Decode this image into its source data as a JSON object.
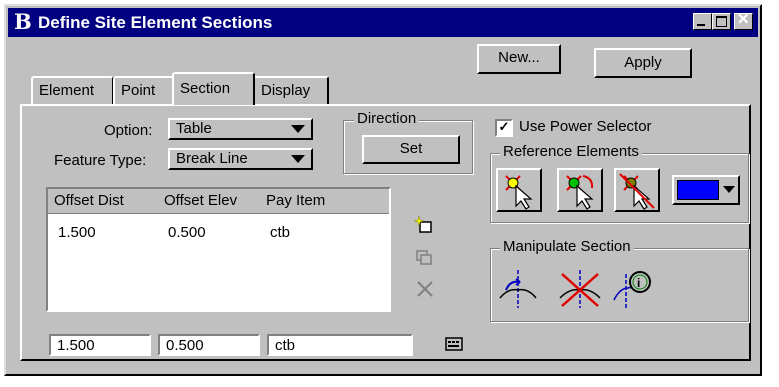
{
  "window": {
    "title": "Define Site Element Sections",
    "title_icon": "B"
  },
  "toolbar": {
    "new_label": "New...",
    "apply_label": "Apply"
  },
  "tabs": [
    {
      "label": "Element",
      "active": false
    },
    {
      "label": "Point",
      "active": false
    },
    {
      "label": "Section",
      "active": true
    },
    {
      "label": "Display",
      "active": false
    }
  ],
  "form": {
    "option_label": "Option:",
    "option_value": "Table",
    "feature_type_label": "Feature Type:",
    "feature_type_value": "Break Line"
  },
  "direction": {
    "group_label": "Direction",
    "set_label": "Set"
  },
  "power_selector": {
    "label": "Use Power Selector",
    "checked": true
  },
  "reference_elements": {
    "group_label": "Reference Elements",
    "color_swatch": "#0000ff"
  },
  "manipulate_section": {
    "group_label": "Manipulate Section"
  },
  "table": {
    "columns": [
      "Offset Dist",
      "Offset Elev",
      "Pay Item"
    ],
    "rows": [
      [
        "1.500",
        "0.500",
        "ctb"
      ]
    ]
  },
  "inputs": {
    "offset_dist": "1.500",
    "offset_elev": "0.500",
    "pay_item": "ctb"
  },
  "colors": {
    "titlebar": "#000080",
    "face": "#c0c0c0",
    "accent_red": "#e00000",
    "accent_green": "#00a000",
    "accent_blue": "#0000ff"
  }
}
